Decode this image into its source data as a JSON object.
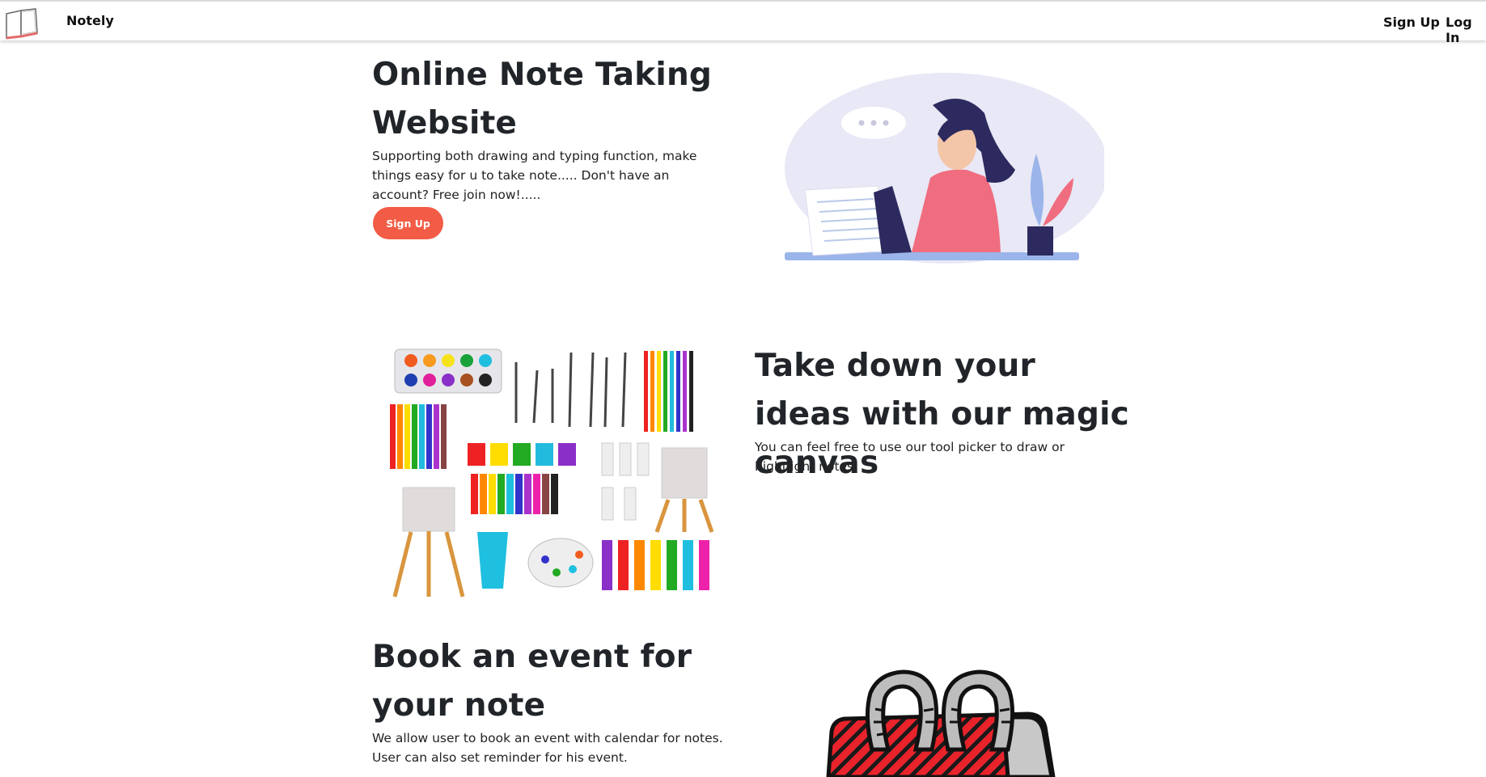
{
  "navbar": {
    "brand": "Notely",
    "signup_label": "Sign Up",
    "login_label": "Log In"
  },
  "hero": {
    "title": "Online Note Taking Website",
    "description": "Supporting both drawing and typing function, make things easy for u to take note..... Don't have an account? Free join now!.....",
    "button_label": "Sign Up"
  },
  "canvas_section": {
    "title": "Take down your ideas with our magic canvas",
    "description": "You can feel free to use our tool picker to draw or hightlight notes"
  },
  "event_section": {
    "title": "Book an event for your note",
    "description": "We allow user to book an event with calendar for notes. User can also set reminder for his event."
  },
  "colors": {
    "accent": "#f25b45",
    "text": "#212529"
  },
  "icons": {
    "brand": "open-book-icon"
  }
}
